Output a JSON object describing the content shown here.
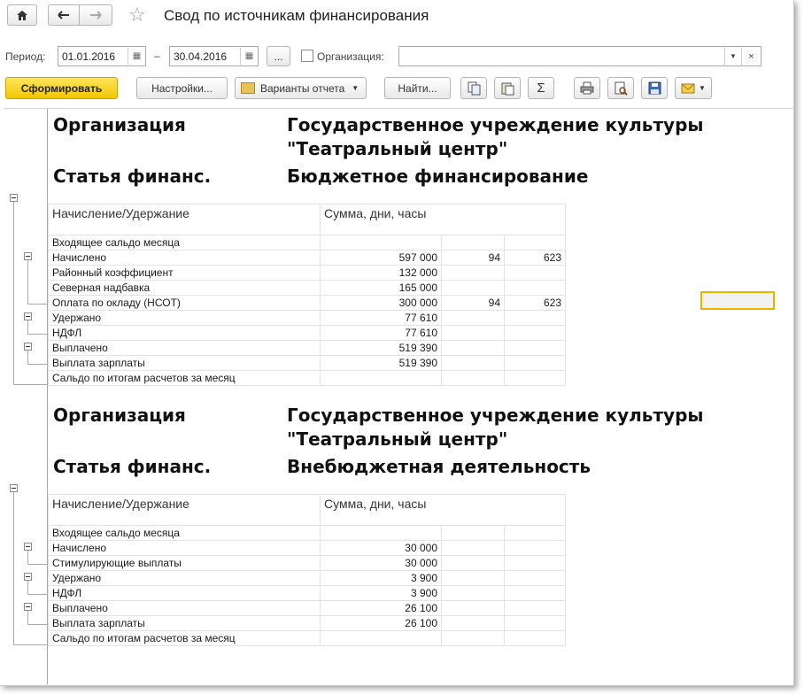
{
  "window": {
    "title": "Свод по источникам финансирования",
    "nav": {
      "home_icon": "home-icon",
      "back_icon": "arrow-left-icon",
      "forward_icon": "arrow-right-icon",
      "favorite_icon": "star-icon"
    }
  },
  "filters": {
    "period_label": "Период:",
    "date_from": "01.01.2016",
    "dash": "–",
    "date_to": "30.04.2016",
    "more_label": "...",
    "org_label": "Организация:",
    "org_value": ""
  },
  "toolbar": {
    "generate_label": "Сформировать",
    "settings_label": "Настройки...",
    "variants_label": "Варианты отчета",
    "find_label": "Найти...",
    "icons": [
      "copy-icon",
      "paste-icon",
      "sum-icon",
      "print-icon",
      "preview-icon",
      "save-icon",
      "mail-icon"
    ]
  },
  "report": {
    "columns": {
      "name": "Начисление/Удержание",
      "sum": "Сумма, дни, часы"
    },
    "groups": [
      {
        "org_label": "Организация",
        "org_line1": "Государственное учреждение культуры",
        "org_line2": "\"Театральный центр\"",
        "article_label": "Статья финанс.",
        "article_value": "Бюджетное финансирование",
        "rows": [
          {
            "name": "Входящее сальдо месяца",
            "sum": "",
            "days": "",
            "hours": ""
          },
          {
            "name": "Начислено",
            "sum": "597 000",
            "days": "94",
            "hours": "623"
          },
          {
            "name": "Районный коэффициент",
            "sum": "132 000",
            "days": "",
            "hours": ""
          },
          {
            "name": "Северная надбавка",
            "sum": "165 000",
            "days": "",
            "hours": ""
          },
          {
            "name": "Оплата по окладу (НСОТ)",
            "sum": "300 000",
            "days": "94",
            "hours": "623"
          },
          {
            "name": "Удержано",
            "sum": "77 610",
            "days": "",
            "hours": ""
          },
          {
            "name": "НДФЛ",
            "sum": "77 610",
            "days": "",
            "hours": ""
          },
          {
            "name": "Выплачено",
            "sum": "519 390",
            "days": "",
            "hours": ""
          },
          {
            "name": "Выплата зарплаты",
            "sum": "519 390",
            "days": "",
            "hours": ""
          },
          {
            "name": "Сальдо по итогам расчетов за месяц",
            "sum": "",
            "days": "",
            "hours": ""
          }
        ]
      },
      {
        "org_label": "Организация",
        "org_line1": "Государственное учреждение культуры",
        "org_line2": "\"Театральный центр\"",
        "article_label": "Статья финанс.",
        "article_value": "Внебюджетная деятельность",
        "rows": [
          {
            "name": "Входящее сальдо месяца",
            "sum": "",
            "days": "",
            "hours": ""
          },
          {
            "name": "Начислено",
            "sum": "30 000",
            "days": "",
            "hours": ""
          },
          {
            "name": "Стимулирующие выплаты",
            "sum": "30 000",
            "days": "",
            "hours": ""
          },
          {
            "name": "Удержано",
            "sum": "3 900",
            "days": "",
            "hours": ""
          },
          {
            "name": "НДФЛ",
            "sum": "3 900",
            "days": "",
            "hours": ""
          },
          {
            "name": "Выплачено",
            "sum": "26 100",
            "days": "",
            "hours": ""
          },
          {
            "name": "Выплата зарплаты",
            "sum": "26 100",
            "days": "",
            "hours": ""
          },
          {
            "name": "Сальдо по итогам расчетов за месяц",
            "sum": "",
            "days": "",
            "hours": ""
          }
        ]
      }
    ]
  },
  "colors": {
    "accent": "#f2c700",
    "selection": "#e8b400"
  }
}
